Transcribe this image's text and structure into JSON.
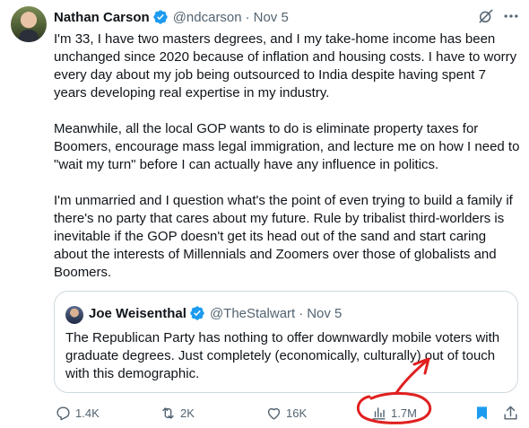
{
  "author": {
    "name": "Nathan Carson",
    "handle": "@ndcarson",
    "separator": "·",
    "date": "Nov 5"
  },
  "body": {
    "paragraphs": [
      "I'm 33, I have two masters degrees, and I my take-home income has been unchanged since 2020 because of inflation and housing costs. I have to worry every day about my job being outsourced to India despite having spent 7 years developing real expertise in my industry.",
      "Meanwhile, all the local GOP wants to do is eliminate property taxes for Boomers, encourage mass legal immigration, and lecture me on how I need to \"wait my turn\" before I can actually have any influence in politics.",
      "I'm unmarried and I question what's the point of even trying to build a family if there's no party that cares about my future. Rule by tribalist third-worlders is inevitable if the GOP doesn't get its head out of the sand and start caring about the interests of Millennials and Zoomers over those of globalists and Boomers."
    ]
  },
  "quote": {
    "name": "Joe Weisenthal",
    "handle": "@TheStalwart",
    "separator": "·",
    "date": "Nov 5",
    "text": "The Republican Party has nothing to offer downwardly mobile voters with graduate degrees. Just completely (economically, culturally) out of touch with this demographic."
  },
  "actions": {
    "replies": "1.4K",
    "reposts": "2K",
    "likes": "16K",
    "views": "1.7M"
  },
  "colors": {
    "verified": "#1d9bf0",
    "muted": "#536471",
    "bookmark": "#1d9bf0",
    "annotation": "#e0201f"
  },
  "icons": [
    "verified-badge-icon",
    "grok-icon",
    "more-icon",
    "reply-icon",
    "repost-icon",
    "like-icon",
    "views-icon",
    "bookmark-icon",
    "share-icon"
  ]
}
